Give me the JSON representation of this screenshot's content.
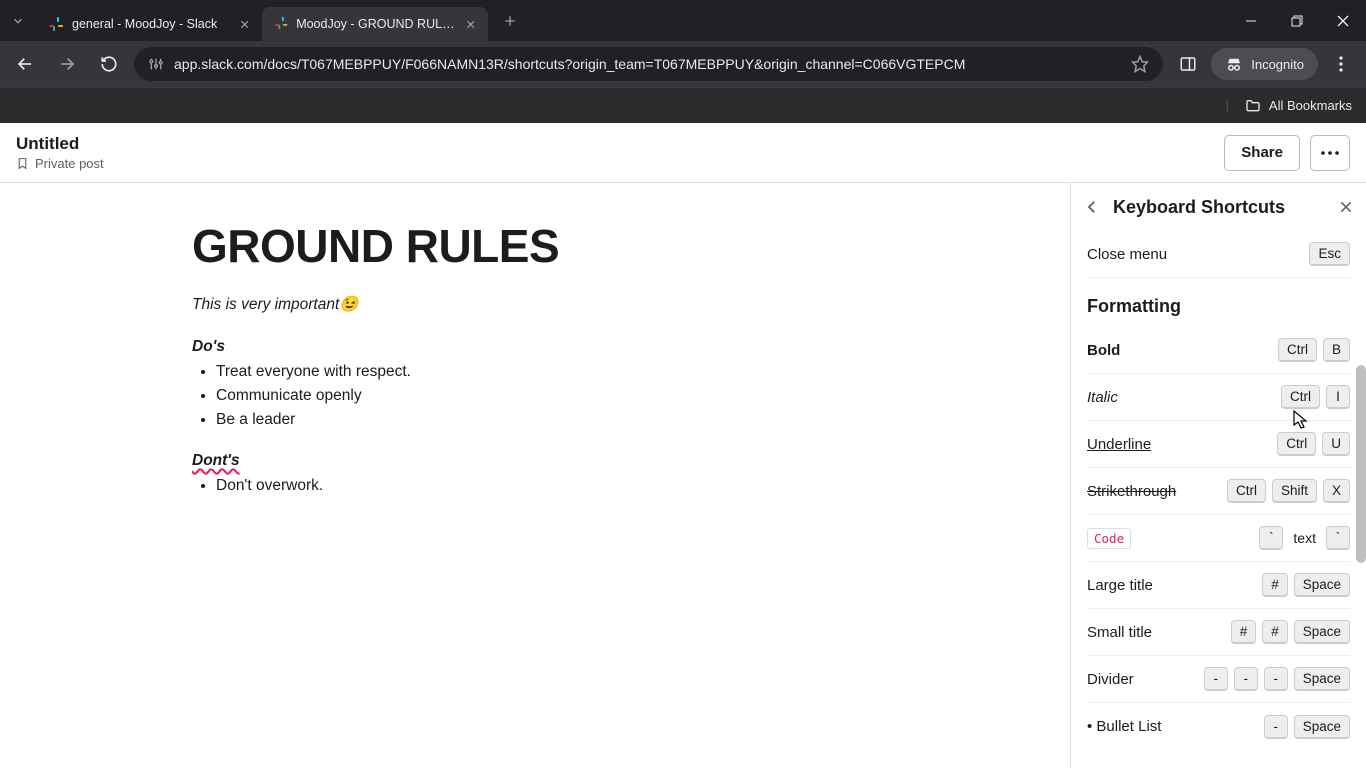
{
  "browser": {
    "tabs": [
      {
        "title": "general - MoodJoy - Slack"
      },
      {
        "title": "MoodJoy - GROUND RULES - S"
      }
    ],
    "url": "app.slack.com/docs/T067MEBPPUY/F066NAMN13R/shortcuts?origin_team=T067MEBPPUY&origin_channel=C066VGTEPCM",
    "incognito_label": "Incognito",
    "all_bookmarks": "All Bookmarks"
  },
  "doc": {
    "window_title": "Untitled",
    "visibility": "Private post",
    "share": "Share",
    "h1": "GROUND RULES",
    "intro": "This is very important",
    "emoji": "😉",
    "dos_heading": "Do's",
    "dos": [
      "Treat everyone with respect.",
      "Communicate openly",
      "Be a leader"
    ],
    "donts_heading": "Dont's",
    "donts": [
      "Don't overwork."
    ]
  },
  "panel": {
    "title": "Keyboard Shortcuts",
    "close_menu": "Close menu",
    "esc": "Esc",
    "formatting": "Formatting",
    "rows": {
      "bold": {
        "label": "Bold",
        "k1": "Ctrl",
        "k2": "B"
      },
      "italic": {
        "label": "Italic",
        "k1": "Ctrl",
        "k2": "I"
      },
      "underline": {
        "label": "Underline",
        "k1": "Ctrl",
        "k2": "U"
      },
      "strike": {
        "label": "Strikethrough",
        "k1": "Ctrl",
        "k2": "Shift",
        "k3": "X"
      },
      "code": {
        "label": "Code",
        "k1": "`",
        "mid": "text",
        "k2": "`"
      },
      "large": {
        "label": "Large title",
        "k1": "#",
        "k2": "Space"
      },
      "small": {
        "label": "Small title",
        "k1": "#",
        "k2": "#",
        "k3": "Space"
      },
      "divider": {
        "label": "Divider",
        "k1": "-",
        "k2": "-",
        "k3": "-",
        "k4": "Space"
      },
      "bullet": {
        "label": "Bullet List",
        "k1": "-",
        "k2": "Space"
      }
    }
  }
}
